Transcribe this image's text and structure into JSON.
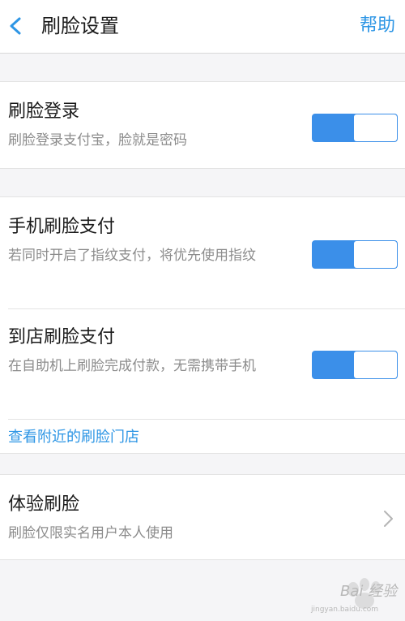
{
  "header": {
    "title": "刷脸设置",
    "help_label": "帮助"
  },
  "items": {
    "face_login": {
      "title": "刷脸登录",
      "desc": "刷脸登录支付宝，脸就是密码",
      "enabled": true
    },
    "phone_face_pay": {
      "title": "手机刷脸支付",
      "desc": "若同时开启了指纹支付，将优先使用指纹",
      "enabled": true
    },
    "store_face_pay": {
      "title": "到店刷脸支付",
      "desc": "在自助机上刷脸完成付款，无需携带手机",
      "enabled": true
    },
    "nearby_link": "查看附近的刷脸门店",
    "try_face": {
      "title": "体验刷脸",
      "desc": "刷脸仅限实名用户本人使用"
    }
  },
  "watermark": {
    "text": "Bai 经验",
    "url": "jingyan.baidu.com"
  },
  "colors": {
    "accent": "#2e96e5",
    "switch_on": "#3b8fe9",
    "background": "#f5f5f7"
  },
  "icons": {
    "back": "chevron-left-icon",
    "row_arrow": "chevron-right-icon",
    "watermark": "paw-icon"
  }
}
